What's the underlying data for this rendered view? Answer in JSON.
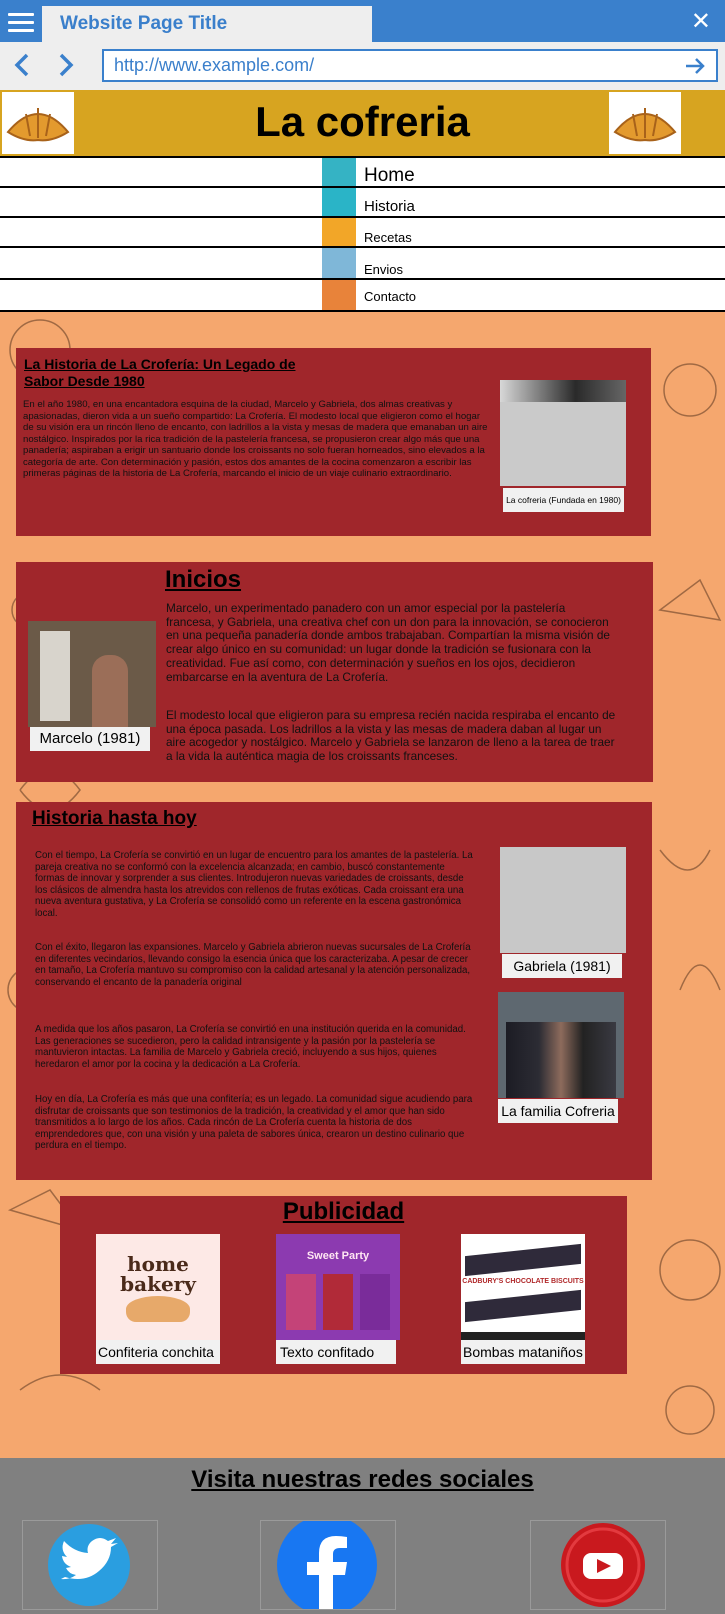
{
  "browser": {
    "tab_title": "Website Page Title",
    "url": "http://www.example.com/"
  },
  "site": {
    "title": "La cofreria",
    "nav": [
      {
        "label": "Home"
      },
      {
        "label": "Historia"
      },
      {
        "label": "Recetas"
      },
      {
        "label": "Envios"
      },
      {
        "label": "Contacto"
      }
    ]
  },
  "historia": {
    "title": "La Historia de La Crofería: Un Legado de Sabor Desde 1980",
    "text": "En el año 1980, en una encantadora esquina de la ciudad, Marcelo y Gabriela, dos almas creativas y apasionadas, dieron vida a un sueño compartido: La Crofería. El modesto local que eligieron como el hogar de su visión era un rincón lleno de encanto, con ladrillos a la vista y mesas de madera que emanaban un aire nostálgico. Inspirados por la rica tradición de la pastelería francesa, se propusieron crear algo más que una panadería; aspiraban a erigir un santuario donde los croissants no solo fueran horneados, sino elevados a la categoría de arte. Con determinación y pasión, estos dos amantes de la cocina comenzaron a escribir las primeras páginas de la historia de La Crofería, marcando el inicio de un viaje culinario extraordinario.",
    "photo_caption": "La cofreria (Fundada en 1980)"
  },
  "inicios": {
    "title": "Inicios",
    "p1": "Marcelo, un experimentado panadero con un amor especial por la pastelería francesa, y Gabriela, una creativa chef con un don para la innovación, se conocieron en una pequeña panadería donde ambos trabajaban. Compartían la misma visión de crear algo único en su comunidad: un lugar donde la tradición se fusionara con la creatividad. Fue así como, con determinación y sueños en los ojos, decidieron embarcarse en la aventura de La Crofería.",
    "p2": "El modesto local que eligieron para su empresa recién nacida respiraba el encanto de una época pasada. Los ladrillos a la vista y las mesas de madera daban al lugar un aire acogedor y nostálgico. Marcelo y Gabriela se lanzaron de lleno a la tarea de traer a la vida la auténtica magia de los croissants franceses.",
    "photo_caption": "Marcelo (1981)"
  },
  "historia_hoy": {
    "title": "Historia hasta hoy",
    "p1": " Con el tiempo, La Crofería se convirtió en un lugar de encuentro para los amantes de la pastelería. La pareja creativa no se conformó con la excelencia alcanzada; en cambio, buscó constantemente formas de innovar y sorprender a sus clientes. Introdujeron nuevas variedades de croissants, desde los clásicos de almendra hasta los atrevidos con rellenos de frutas exóticas. Cada croissant era una nueva aventura gustativa, y La Crofería se consolidó como un referente en la escena gastronómica local.",
    "p2": "Con el éxito, llegaron las expansiones. Marcelo y Gabriela abrieron nuevas sucursales de La Crofería en diferentes vecindarios, llevando consigo la esencia única que los caracterizaba. A pesar de crecer en tamaño, La Crofería mantuvo su compromiso con la calidad artesanal y la atención personalizada, conservando el encanto de la panadería original",
    "p3": "A medida que los años pasaron, La Crofería se convirtió en una institución querida en la comunidad. Las generaciones se sucedieron, pero la calidad intransigente y la pasión por la pastelería se mantuvieron intactas. La familia de Marcelo y Gabriela creció, incluyendo a sus hijos, quienes heredaron el amor por la cocina y la dedicación a La Crofería.",
    "p4": "Hoy en día, La Crofería es más que una confitería; es un legado. La comunidad sigue acudiendo para disfrutar de croissants que son testimonios de la tradición, la creatividad y el amor que han sido transmitidos a lo largo de los años. Cada rincón de La Crofería cuenta la historia de dos emprendedores que, con una visión y una paleta de sabores única, crearon un destino culinario que perdura en el tiempo.",
    "photo1_caption": "Gabriela (1981)",
    "photo2_caption": "La familia Cofreria"
  },
  "publicidad": {
    "title": "Publicidad",
    "ads": [
      {
        "caption": "Confiteria conchita",
        "logo_text": "home bakery"
      },
      {
        "caption": "Texto confitado",
        "logo_text": "Sweet Party"
      },
      {
        "caption": "Bombas mataniños",
        "logo_text": "CADBURY'S CHOCOLATE BISCUITS"
      }
    ]
  },
  "footer": {
    "title": "Visita nuestras redes sociales",
    "socials": [
      {
        "icon": "twitter-icon"
      },
      {
        "icon": "facebook-icon"
      },
      {
        "icon": "youtube-icon"
      }
    ]
  }
}
